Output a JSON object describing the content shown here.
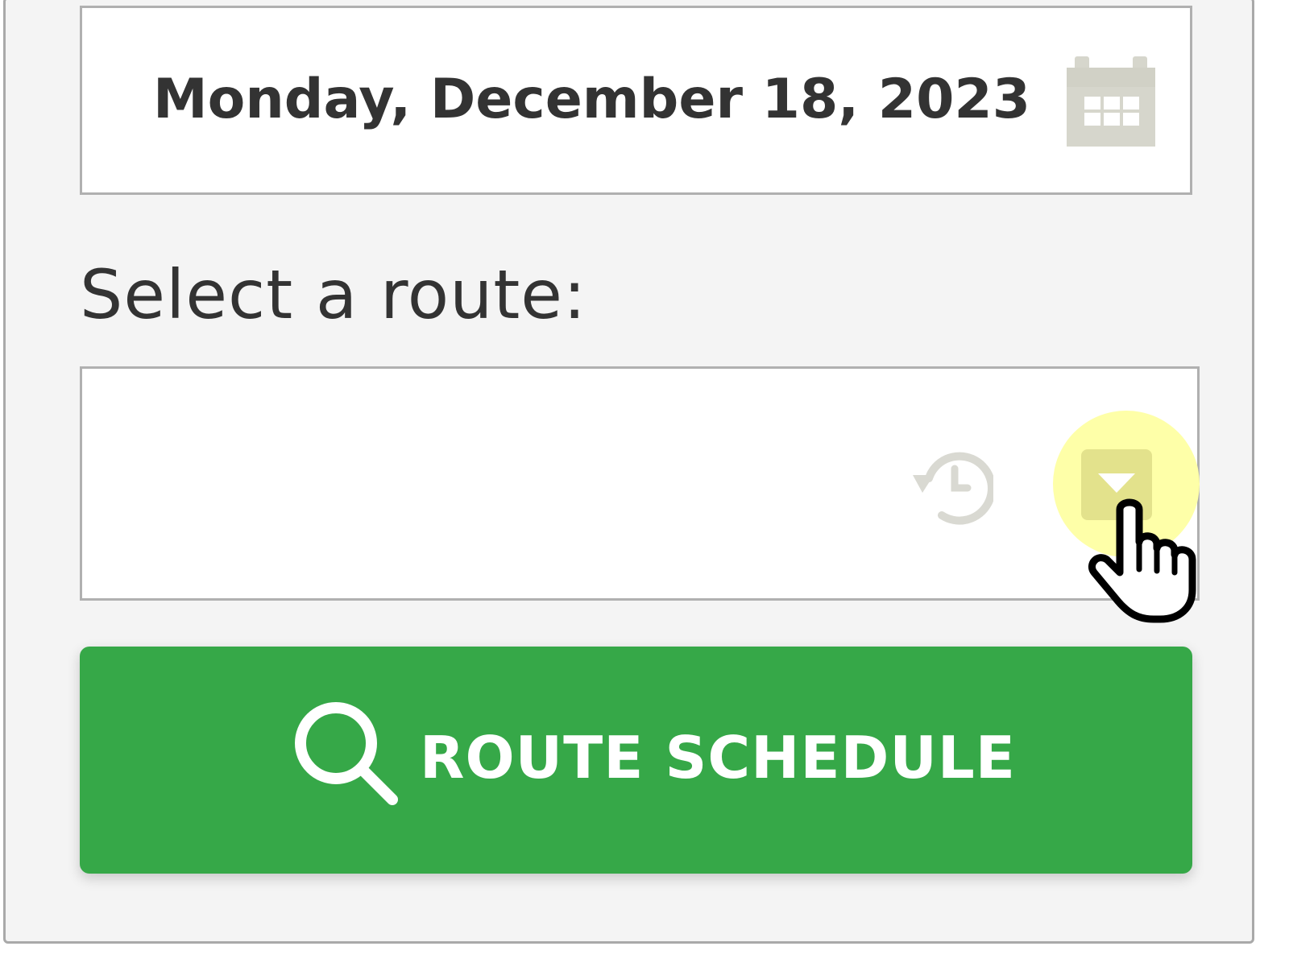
{
  "date_picker": {
    "value": "Monday, December 18, 2023",
    "icon": "calendar-icon"
  },
  "route": {
    "label": "Select a route:",
    "value": "",
    "history_icon": "history-icon",
    "dropdown_icon": "chevron-down-icon"
  },
  "search_button": {
    "label": "ROUTE SCHEDULE",
    "icon": "search-icon"
  },
  "colors": {
    "panel_background": "#f4f4f4",
    "button_green": "#36a848",
    "text_dark": "#333333",
    "icon_gray": "#d6d6cc",
    "highlight_yellow": "#feffa8"
  }
}
